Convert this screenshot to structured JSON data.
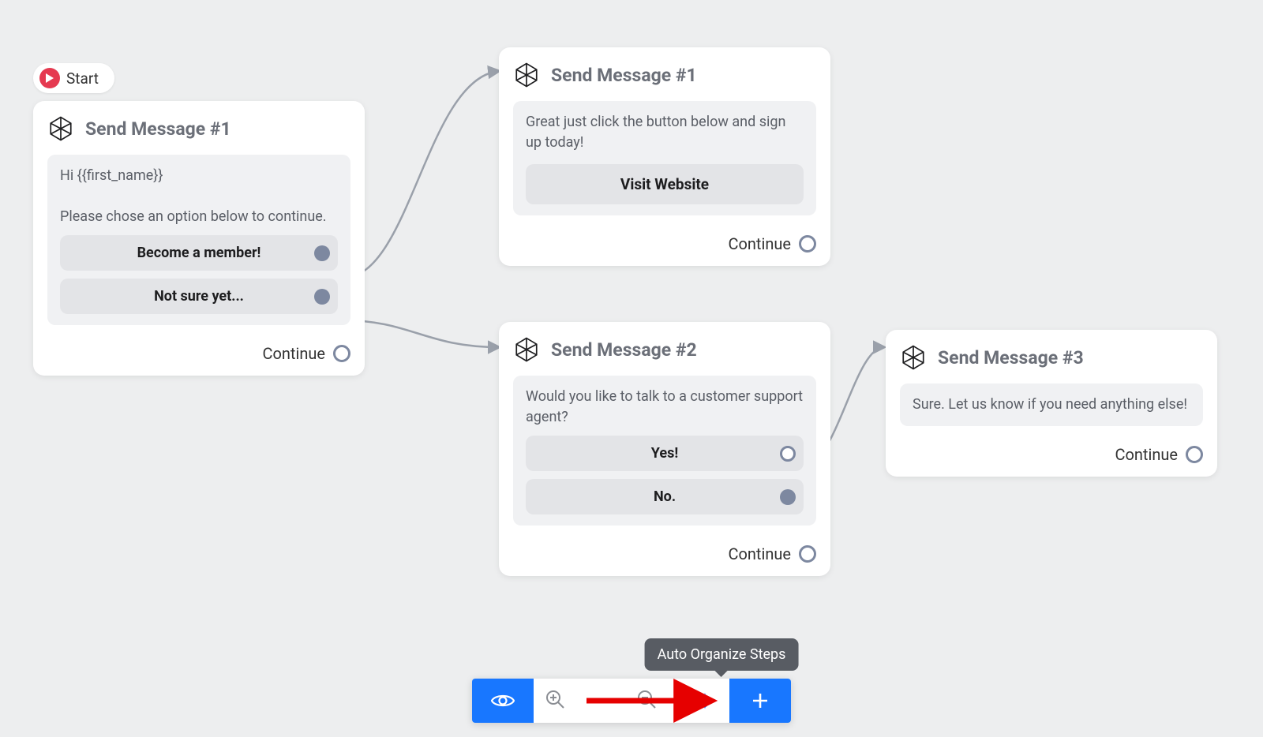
{
  "start": {
    "label": "Start"
  },
  "nodes": {
    "n1": {
      "title": "Send Message #1",
      "message": "Hi {{first_name}}\n\nPlease chose an option below to continue.",
      "options": [
        {
          "label": "Become a member!",
          "port": "filled"
        },
        {
          "label": "Not sure yet...",
          "port": "filled"
        }
      ],
      "continue": "Continue"
    },
    "n2": {
      "title": "Send Message #1",
      "message": "Great just click the button below and sign up today!",
      "button": "Visit Website",
      "continue": "Continue"
    },
    "n3": {
      "title": "Send Message #2",
      "message": "Would you like to talk to a customer support agent?",
      "options": [
        {
          "label": "Yes!",
          "port": "open"
        },
        {
          "label": "No.",
          "port": "filled"
        }
      ],
      "continue": "Continue"
    },
    "n4": {
      "title": "Send Message #3",
      "message": "Sure. Let us know if you need anything else!",
      "continue": "Continue"
    }
  },
  "toolbar": {
    "tooltip": "Auto Organize Steps"
  }
}
